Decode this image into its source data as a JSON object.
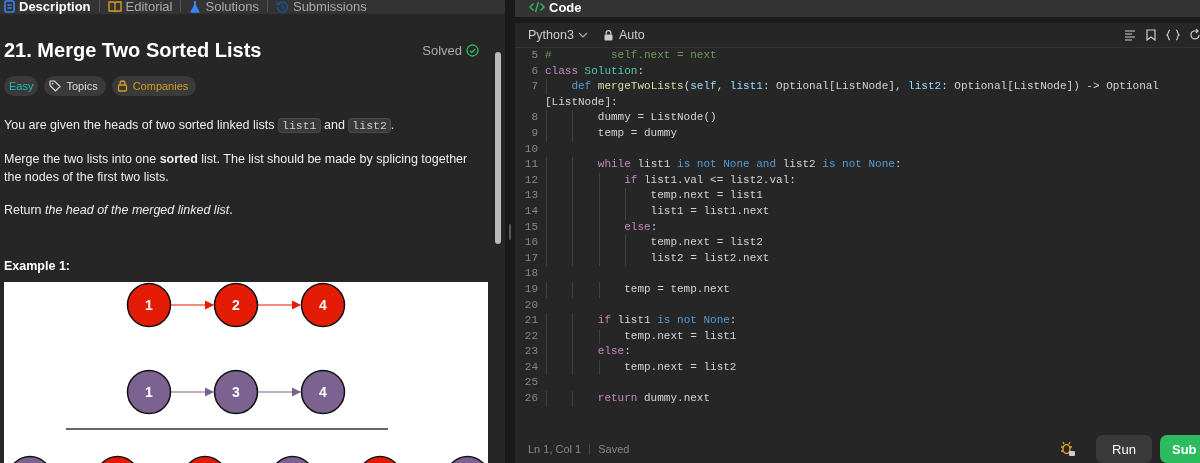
{
  "left_tabs": [
    {
      "label": "Description",
      "selected": true
    },
    {
      "label": "Editorial",
      "selected": false
    },
    {
      "label": "Solutions",
      "selected": false
    },
    {
      "label": "Submissions",
      "selected": false
    }
  ],
  "problem": {
    "title": "21. Merge Two Sorted Lists",
    "status": "Solved",
    "tags": [
      {
        "label": "Easy",
        "kind": "difficulty"
      },
      {
        "label": "Topics",
        "kind": "topics"
      },
      {
        "label": "Companies",
        "kind": "companies"
      }
    ],
    "paragraphs": [
      [
        {
          "kind": "text",
          "text": "You are given the heads of two sorted linked lists "
        },
        {
          "kind": "code",
          "text": "list1"
        },
        {
          "kind": "text",
          "text": " and "
        },
        {
          "kind": "code",
          "text": "list2"
        },
        {
          "kind": "text",
          "text": "."
        }
      ],
      [
        {
          "kind": "text",
          "text": "Merge the two lists into one **sorted** list. The list should be made by splicing together the nodes of the first two lists."
        }
      ],
      [
        {
          "kind": "text",
          "text": "Return *the head of the merged linked list*."
        }
      ]
    ],
    "example_title": "Example 1:",
    "diagram": {
      "lists": [
        [
          {
            "value": "1",
            "color": "#e41b05"
          },
          {
            "value": "2",
            "color": "#e41b05"
          },
          {
            "value": "4",
            "color": "#e41b05"
          }
        ],
        [
          {
            "value": "1",
            "color": "#7b6290"
          },
          {
            "value": "3",
            "color": "#7b6290"
          },
          {
            "value": "4",
            "color": "#7b6290"
          }
        ]
      ],
      "merged": [
        {
          "color": "#7b6290"
        },
        {
          "color": "#e41b05"
        },
        {
          "color": "#e41b05"
        },
        {
          "color": "#7b6290"
        },
        {
          "color": "#e41b05"
        },
        {
          "color": "#7b6290"
        }
      ]
    }
  },
  "code_panel": {
    "title": "Code",
    "language": "Python3",
    "mode": "Auto",
    "lines": [
      {
        "number": "5",
        "tokens": [
          {
            "kind": "comment",
            "text": "#         self.next = next"
          }
        ]
      },
      {
        "number": "6",
        "tokens": [
          {
            "kind": "keyword",
            "text": "class"
          },
          {
            "kind": "class",
            "text": " Solution"
          },
          {
            "kind": "plain",
            "text": ":"
          }
        ]
      },
      {
        "number": "7",
        "tokens": [
          {
            "kind": "keyword2",
            "text": "    def"
          },
          {
            "kind": "function",
            "text": " mergeTwoLists"
          },
          {
            "kind": "plain",
            "text": "("
          },
          {
            "kind": "param",
            "text": "self"
          },
          {
            "kind": "plain",
            "text": ", "
          },
          {
            "kind": "param",
            "text": "list1"
          },
          {
            "kind": "plain",
            "text": ": Optional[ListNode], "
          },
          {
            "kind": "param",
            "text": "list2"
          },
          {
            "kind": "plain",
            "text": ": Optional[ListNode]) -> Optional"
          }
        ]
      },
      {
        "tokens": [
          {
            "kind": "plain",
            "text": "[ListNode]:"
          }
        ]
      },
      {
        "number": "8",
        "tokens": [
          {
            "kind": "plain",
            "text": "        dummy = ListNode()"
          }
        ]
      },
      {
        "number": "9",
        "tokens": [
          {
            "kind": "plain",
            "text": "        temp = dummy"
          }
        ]
      },
      {
        "number": "10"
      },
      {
        "number": "11",
        "tokens": [
          {
            "kind": "keyword",
            "text": "        while"
          },
          {
            "kind": "plain",
            "text": " list1 "
          },
          {
            "kind": "operator",
            "text": "is not None and"
          },
          {
            "kind": "plain",
            "text": " list2 "
          },
          {
            "kind": "operator",
            "text": "is not None"
          },
          {
            "kind": "plain",
            "text": ":"
          }
        ]
      },
      {
        "number": "12",
        "tokens": [
          {
            "kind": "keyword",
            "text": "            if"
          },
          {
            "kind": "plain",
            "text": " list1.val <= list2.val:"
          }
        ]
      },
      {
        "number": "13",
        "tokens": [
          {
            "kind": "plain",
            "text": "                temp.next = list1"
          }
        ]
      },
      {
        "number": "14",
        "tokens": [
          {
            "kind": "plain",
            "text": "                list1 = list1.next"
          }
        ]
      },
      {
        "number": "15",
        "tokens": [
          {
            "kind": "keyword",
            "text": "            else"
          },
          {
            "kind": "plain",
            "text": ":"
          }
        ]
      },
      {
        "number": "16",
        "tokens": [
          {
            "kind": "plain",
            "text": "                temp.next = list2"
          }
        ]
      },
      {
        "number": "17",
        "tokens": [
          {
            "kind": "plain",
            "text": "                list2 = list2.next"
          }
        ]
      },
      {
        "number": "18"
      },
      {
        "number": "19",
        "tokens": [
          {
            "kind": "plain",
            "text": "            temp = temp.next"
          }
        ]
      },
      {
        "number": "20"
      },
      {
        "number": "21",
        "tokens": [
          {
            "kind": "keyword",
            "text": "        if"
          },
          {
            "kind": "plain",
            "text": " list1 "
          },
          {
            "kind": "operator",
            "text": "is not None"
          },
          {
            "kind": "plain",
            "text": ":"
          }
        ]
      },
      {
        "number": "22",
        "tokens": [
          {
            "kind": "plain",
            "text": "            temp.next = list1"
          }
        ]
      },
      {
        "number": "23",
        "tokens": [
          {
            "kind": "keyword",
            "text": "        else"
          },
          {
            "kind": "plain",
            "text": ":"
          }
        ]
      },
      {
        "number": "24",
        "tokens": [
          {
            "kind": "plain",
            "text": "            temp.next = list2"
          }
        ]
      },
      {
        "number": "25"
      },
      {
        "number": "26",
        "tokens": [
          {
            "kind": "keyword",
            "text": "        return"
          },
          {
            "kind": "plain",
            "text": " dummy.next"
          }
        ]
      }
    ],
    "cursor": "Ln 1, Col 1",
    "save_state": "Saved",
    "run_label": "Run",
    "submit_label": "Sub"
  }
}
